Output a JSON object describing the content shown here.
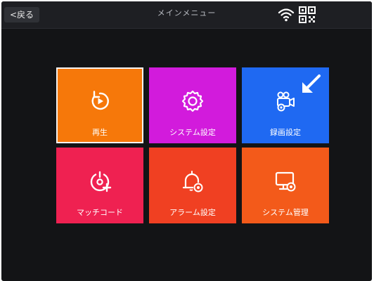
{
  "header": {
    "back_label": "<戻る",
    "title": "メインメニュー",
    "wifi_icon": "wifi-icon",
    "qr_icon": "qr-code-icon"
  },
  "colors": {
    "background": "#131416",
    "header": "#1e1f23",
    "tile_playback": "#f6780a",
    "tile_system_settings": "#d21bdc",
    "tile_recording_settings": "#1f69f2",
    "tile_match_code": "#ef2151",
    "tile_alarm_settings": "#f04022",
    "tile_system_management": "#f35a1a"
  },
  "tiles": [
    {
      "label": "再生",
      "icon": "playback-icon",
      "selected": true
    },
    {
      "label": "システム設定",
      "icon": "gear-icon",
      "selected": false
    },
    {
      "label": "録画設定",
      "icon": "camera-settings-icon",
      "selected": false
    },
    {
      "label": "マッチコード",
      "icon": "pairing-icon",
      "selected": false
    },
    {
      "label": "アラーム設定",
      "icon": "alarm-bell-icon",
      "selected": false
    },
    {
      "label": "システム管理",
      "icon": "monitor-settings-icon",
      "selected": false
    }
  ]
}
